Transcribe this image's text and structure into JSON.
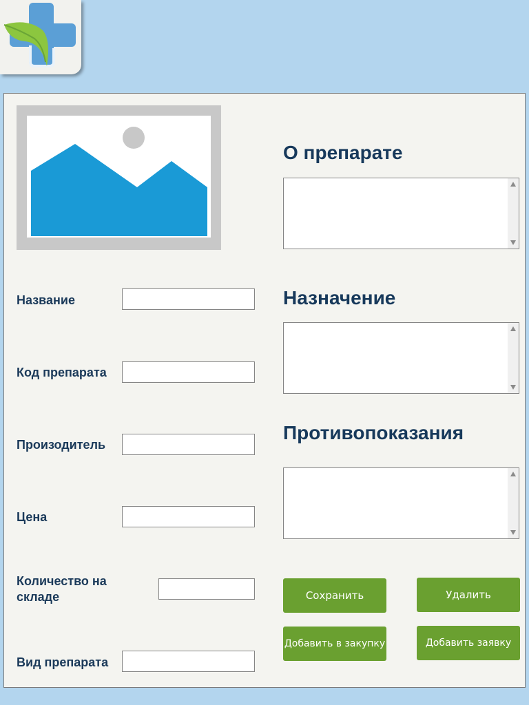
{
  "form": {
    "name_label": "Название",
    "name_value": "",
    "code_label": "Код препарата",
    "code_value": "",
    "manufacturer_label": "Произодитель",
    "manufacturer_value": "",
    "price_label": "Цена",
    "price_value": "",
    "stock_label": "Количество на складе",
    "stock_value": "",
    "type_label": "Вид препарата",
    "type_value": ""
  },
  "sections": {
    "about_title": "О препарате",
    "about_text": "",
    "purpose_title": "Назначение",
    "purpose_text": "",
    "contraindications_title": "Противопоказания",
    "contraindications_text": ""
  },
  "buttons": {
    "save": "Сохранить",
    "delete": "Удалить",
    "add_to_purchase": "Добавить в закупку",
    "add_request": "Добавить заявку"
  },
  "colors": {
    "background": "#b3d5ee",
    "panel": "#f4f4f0",
    "accent_green": "#6aa030",
    "title_blue": "#17395b",
    "image_placeholder_blue": "#1a9ad6"
  },
  "icons": {
    "logo": "pharmacy-cross-leaf-icon",
    "image_placeholder": "image-placeholder-icon"
  }
}
